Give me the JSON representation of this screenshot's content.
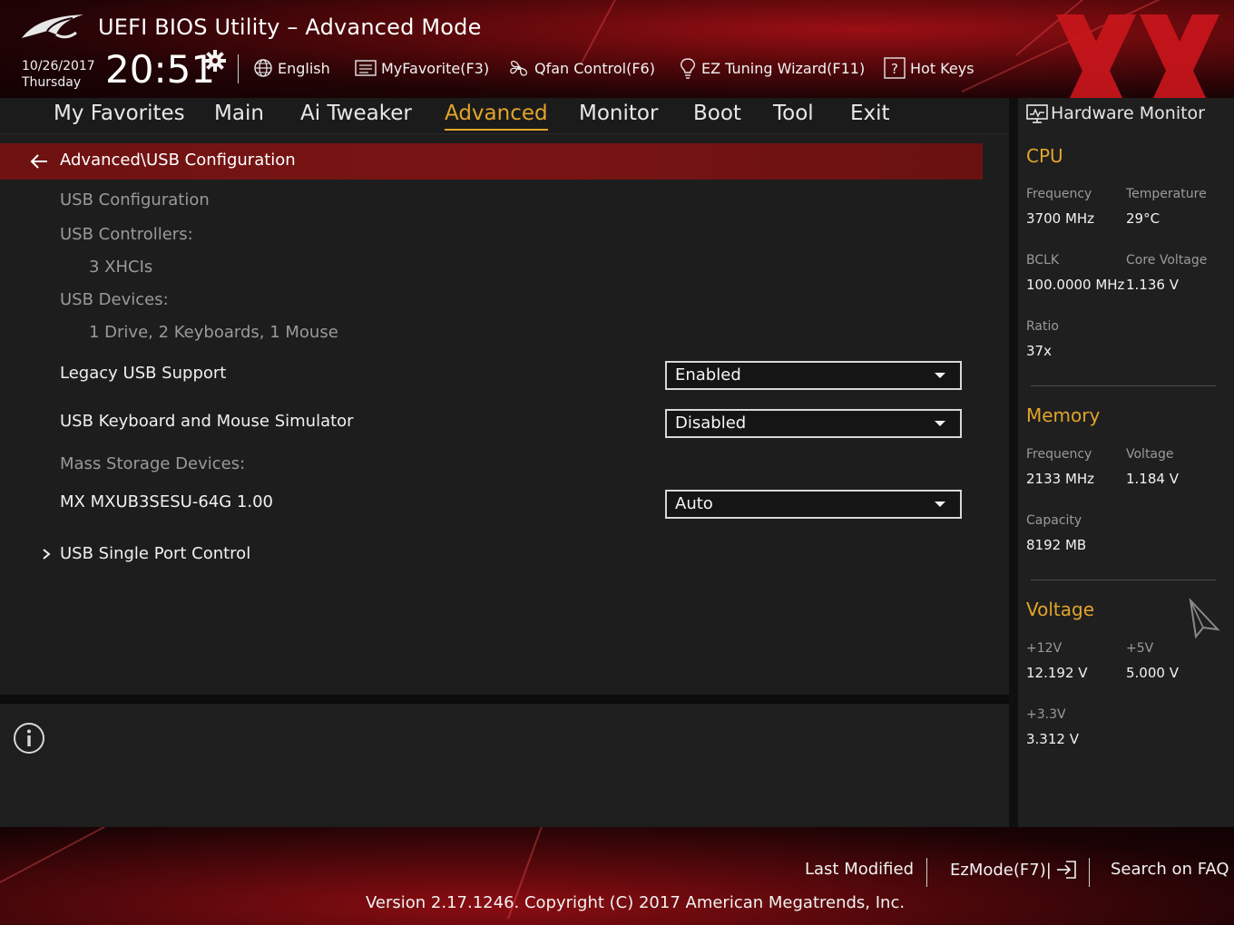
{
  "header": {
    "title": "UEFI BIOS Utility – Advanced Mode",
    "date": "10/26/2017",
    "day": "Thursday",
    "time": "20:51",
    "items": [
      {
        "label": "English",
        "icon": "globe-icon"
      },
      {
        "label": "MyFavorite(F3)",
        "icon": "favorite-list-icon"
      },
      {
        "label": "Qfan Control(F6)",
        "icon": "fan-icon"
      },
      {
        "label": "EZ Tuning Wizard(F11)",
        "icon": "lightbulb-icon"
      },
      {
        "label": "Hot Keys",
        "icon": "question-box-icon"
      }
    ]
  },
  "nav": {
    "tabs": [
      {
        "label": "My Favorites"
      },
      {
        "label": "Main"
      },
      {
        "label": "Ai Tweaker"
      },
      {
        "label": "Advanced",
        "active": true
      },
      {
        "label": "Monitor"
      },
      {
        "label": "Boot"
      },
      {
        "label": "Tool"
      },
      {
        "label": "Exit"
      }
    ]
  },
  "main": {
    "breadcrumb": "Advanced\\USB Configuration",
    "rows": [
      {
        "label": "USB Configuration"
      },
      {
        "label": "USB Controllers:"
      },
      {
        "label": "3 XHCIs"
      },
      {
        "label": "USB Devices:"
      },
      {
        "label": "1 Drive, 2 Keyboards, 1 Mouse"
      },
      {
        "label": "Legacy USB Support",
        "value": "Enabled"
      },
      {
        "label": "USB Keyboard and Mouse Simulator",
        "value": "Disabled"
      },
      {
        "label": "Mass Storage Devices:"
      },
      {
        "label": "MX MXUB3SESU-64G 1.00",
        "value": "Auto"
      },
      {
        "label": "USB Single Port Control"
      }
    ]
  },
  "hardware_monitor": {
    "title": "Hardware Monitor",
    "cpu": {
      "section": "CPU",
      "frequency_label": "Frequency",
      "frequency": "3700 MHz",
      "temperature_label": "Temperature",
      "temperature": "29°C",
      "bclk_label": "BCLK",
      "bclk": "100.0000 MHz",
      "core_voltage_label": "Core Voltage",
      "core_voltage": "1.136 V",
      "ratio_label": "Ratio",
      "ratio": "37x"
    },
    "memory": {
      "section": "Memory",
      "frequency_label": "Frequency",
      "frequency": "2133 MHz",
      "voltage_label": "Voltage",
      "voltage": "1.184 V",
      "capacity_label": "Capacity",
      "capacity": "8192 MB"
    },
    "voltage": {
      "section": "Voltage",
      "v12_label": "+12V",
      "v12": "12.192 V",
      "v5_label": "+5V",
      "v5": "5.000 V",
      "v33_label": "+3.3V",
      "v33": "3.312 V"
    }
  },
  "footer": {
    "last_modified": "Last Modified",
    "ezmode": "EzMode(F7)|",
    "search_faq": "Search on FAQ",
    "version": "Version 2.17.1246. Copyright (C) 2017 American Megatrends, Inc."
  },
  "colors": {
    "accent": "#e2a52a",
    "breadcrumb_bg": "#7a1414",
    "brand_red": "#9a0f14"
  }
}
